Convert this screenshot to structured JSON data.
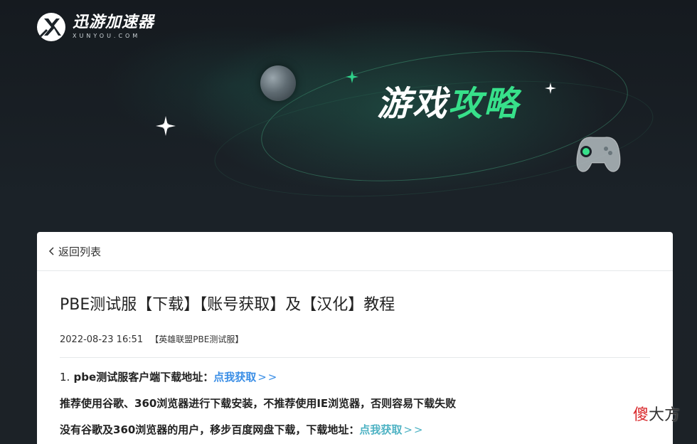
{
  "brand": {
    "name_cn": "迅游加速器",
    "name_en": "XUNYOU.COM"
  },
  "banner": {
    "title_white": "游戏",
    "title_green": "攻略",
    "accent_color": "#37e08a"
  },
  "nav": {
    "back_label": "返回列表"
  },
  "article": {
    "title": "PBE测试服【下载】【账号获取】及【汉化】教程",
    "date": "2022-08-23 16:51",
    "category": "【英雄联盟PBE测试服】",
    "paragraphs": {
      "p1_num": "1.",
      "p1_text": "pbe测试服客户端下载地址：",
      "p1_link": "点我获取",
      "p1_arrow": ">>",
      "p2_text": "推荐使用谷歌、360浏览器进行下载安装，不推荐使用IE浏览器，否则容易下载失败",
      "p3_text": "没有谷歌及360浏览器的用户，移步百度网盘下载，下载地址：",
      "p3_link": "点我获取",
      "p3_arrow": ">>"
    }
  },
  "watermark": {
    "c1": "傻",
    "c2": "大方"
  },
  "colors": {
    "link_blue": "#3a8ee6",
    "link_teal": "#4fb3c4",
    "hero_bg": "#1a2025"
  }
}
